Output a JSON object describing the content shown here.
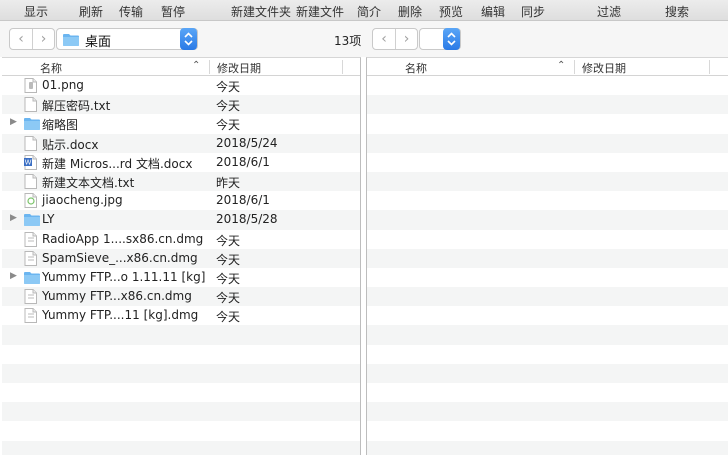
{
  "toolbar": {
    "items": [
      "显示",
      "刷新",
      "传输",
      "暂停",
      "新建文件夹",
      "新建文件",
      "简介",
      "删除",
      "预览",
      "编辑",
      "同步",
      "过滤",
      "搜索"
    ]
  },
  "left": {
    "path": "桌面",
    "count": "13项",
    "columns": {
      "name": "名称",
      "date": "修改日期"
    },
    "files": [
      {
        "name": "01.png",
        "date": "今天",
        "icon": "png-file-icon",
        "expandable": false
      },
      {
        "name": "解压密码.txt",
        "date": "今天",
        "icon": "text-file-icon",
        "expandable": false
      },
      {
        "name": "缩略图",
        "date": "今天",
        "icon": "folder-icon",
        "expandable": true
      },
      {
        "name": "贴示.docx",
        "date": "2018/5/24",
        "icon": "document-file-icon",
        "expandable": false
      },
      {
        "name": "新建 Micros...rd 文档.docx",
        "date": "2018/6/1",
        "icon": "word-file-icon",
        "expandable": false
      },
      {
        "name": "新建文本文档.txt",
        "date": "昨天",
        "icon": "text-file-icon",
        "expandable": false
      },
      {
        "name": "jiaocheng.jpg",
        "date": "2018/6/1",
        "icon": "jpg-file-icon",
        "expandable": false
      },
      {
        "name": "LY",
        "date": "2018/5/28",
        "icon": "folder-icon",
        "expandable": true
      },
      {
        "name": "RadioApp 1....sx86.cn.dmg",
        "date": "今天",
        "icon": "dmg-file-icon",
        "expandable": false
      },
      {
        "name": "SpamSieve_...x86.cn.dmg",
        "date": "今天",
        "icon": "dmg-file-icon",
        "expandable": false
      },
      {
        "name": "Yummy FTP...o 1.11.11 [kg]",
        "date": "今天",
        "icon": "folder-icon",
        "expandable": true
      },
      {
        "name": "Yummy FTP...x86.cn.dmg",
        "date": "今天",
        "icon": "dmg-file-icon",
        "expandable": false
      },
      {
        "name": "Yummy FTP....11 [kg].dmg",
        "date": "今天",
        "icon": "dmg-file-icon",
        "expandable": false
      }
    ]
  },
  "right": {
    "path": "",
    "columns": {
      "name": "名称",
      "date": "修改日期"
    }
  },
  "colors": {
    "accent": "#2a7ae6",
    "folder": "#6bb5f0",
    "zebra": "#f4f5f5"
  }
}
